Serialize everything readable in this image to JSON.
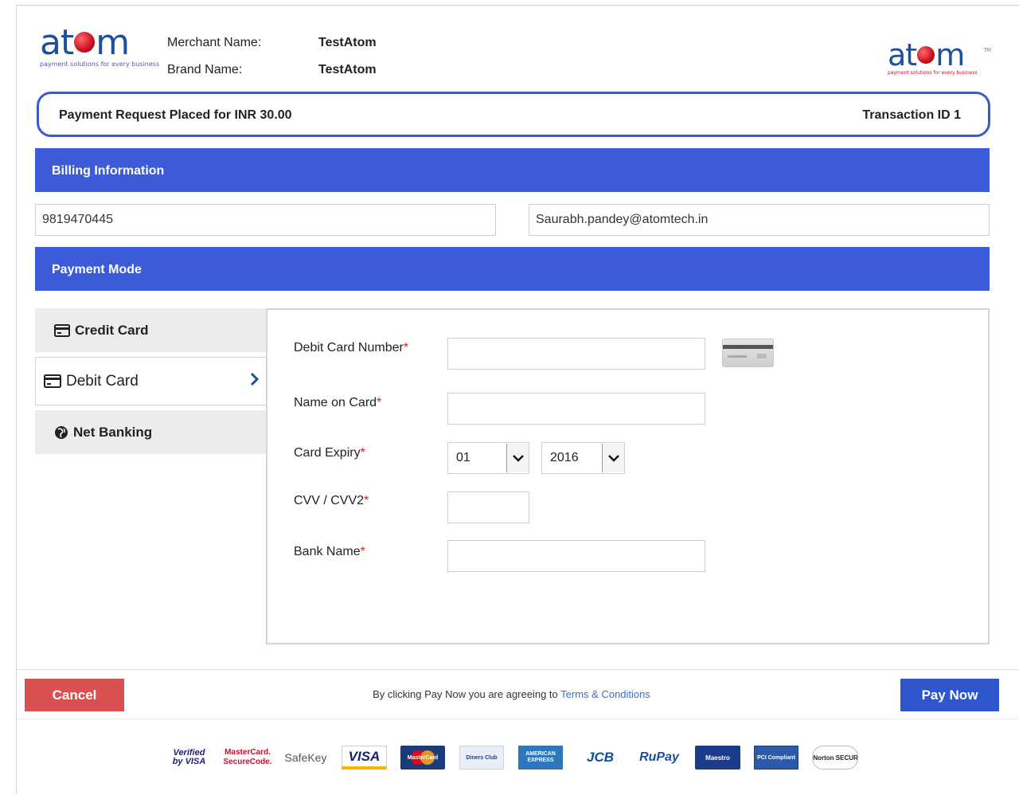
{
  "header": {
    "logo_left": {
      "word_pre": "at",
      "word_post": "m",
      "tagline": "payment solutions for every business"
    },
    "logo_right": {
      "word_pre": "at",
      "word_post": "m",
      "tagline": "payment solutions for every business",
      "tm": "TM"
    },
    "merchant_label": "Merchant Name:",
    "merchant_value": "TestAtom",
    "brand_label": "Brand Name:",
    "brand_value": "TestAtom"
  },
  "summary": {
    "amount_text": "Payment Request Placed for INR  30.00",
    "transaction_text": "Transaction ID  1"
  },
  "billing": {
    "title": "Billing Information",
    "phone": "9819470445",
    "email": "Saurabh.pandey@atomtech.in"
  },
  "payment_mode": {
    "title": "Payment Mode",
    "tabs": [
      {
        "label": "Credit Card",
        "icon": "credit-card-icon"
      },
      {
        "label": "Debit Card",
        "icon": "credit-card-icon",
        "active": true
      },
      {
        "label": "Net Banking",
        "icon": "globe-icon"
      }
    ]
  },
  "form": {
    "card_number_label": "Debit Card Number",
    "name_label": "Name on Card",
    "expiry_label": "Card Expiry",
    "cvv_label": "CVV / CVV2",
    "bank_label": "Bank Name",
    "required_mark": "*",
    "expiry_month": "01",
    "expiry_year": "2016"
  },
  "footer": {
    "cancel_label": "Cancel",
    "pay_label": "Pay Now",
    "terms_prefix": "By clicking Pay Now you are agreeing to",
    "terms_link": "Terms & Conditions",
    "badges": [
      {
        "text": "Verified by VISA",
        "name": "verified-by-visa-badge"
      },
      {
        "text": "MasterCard. SecureCode.",
        "name": "mastercard-securecode-badge"
      },
      {
        "text": "SafeKey",
        "name": "amex-safekey-badge"
      },
      {
        "text": "VISA",
        "name": "visa-badge"
      },
      {
        "text": "MasterCard",
        "name": "mastercard-badge"
      },
      {
        "text": "Diners Club",
        "name": "diners-club-badge"
      },
      {
        "text": "AMERICAN EXPRESS",
        "name": "american-express-badge"
      },
      {
        "text": "JCB",
        "name": "jcb-badge"
      },
      {
        "text": "RuPay",
        "name": "rupay-badge"
      },
      {
        "text": "Maestro",
        "name": "maestro-badge"
      },
      {
        "text": "PCI Compliant",
        "name": "pci-compliant-badge"
      },
      {
        "text": "Norton SECURED",
        "name": "norton-secured-badge"
      }
    ]
  },
  "colors": {
    "accent_blue": "#3b5bd8",
    "cancel_red": "#da4f4f",
    "pay_blue": "#2f56cc",
    "logo_blue": "#1c4fa0",
    "logo_red": "#c80f1e"
  }
}
